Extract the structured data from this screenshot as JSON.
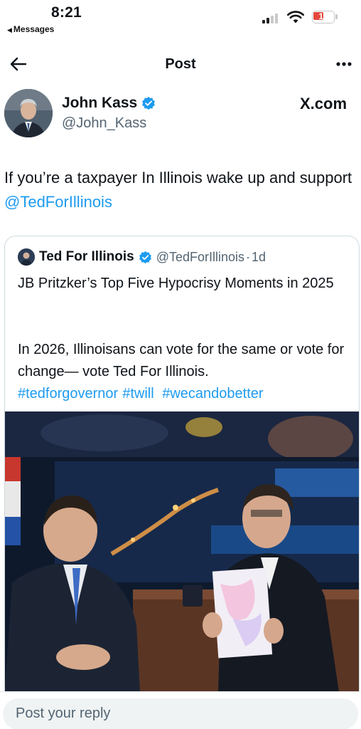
{
  "status_bar": {
    "time": "8:21",
    "back_app": "Messages",
    "battery": "17",
    "battery_color": "#e5483d"
  },
  "nav": {
    "back_icon": "arrow-left-icon",
    "title": "Post",
    "more_icon": "more-horizontal-icon"
  },
  "author": {
    "name": "John Kass",
    "handle": "@John_Kass",
    "source": "X.com"
  },
  "tweet": {
    "text": "If you’re a taxpayer In Illinois wake up and support ",
    "mention": "@TedForIllinois"
  },
  "quote": {
    "name": "Ted For Illinois",
    "handle": "@TedForIllinois",
    "separator": "·",
    "time": "1d",
    "title": "JB Pritzker’s Top Five Hypocrisy Moments in 2025",
    "body": "In 2026, Illinoisans can vote for the same or vote for change— vote Ted For Illinois.",
    "hashtags": [
      "#tedforgovernor",
      "#twill",
      "#wecandobetter"
    ]
  },
  "reply": {
    "placeholder": "Post your reply"
  },
  "colors": {
    "link": "#1d9bf0",
    "secondary_text": "#536471",
    "verified": "#1d9bf0"
  }
}
